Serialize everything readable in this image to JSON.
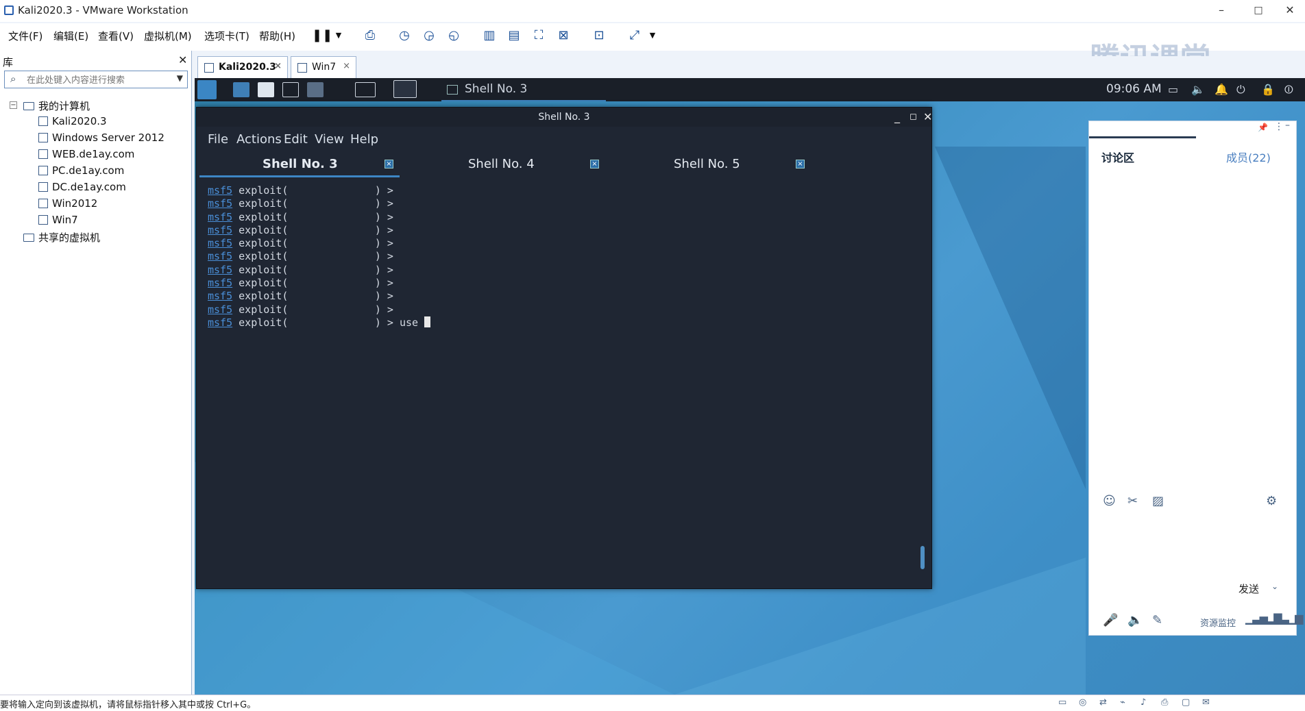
{
  "window": {
    "title": "Kali2020.3 - VMware Workstation",
    "minimize": "–",
    "maximize": "□",
    "close": "✕"
  },
  "menubar": {
    "items": [
      "文件(F)",
      "编辑(E)",
      "查看(V)",
      "虚拟机(M)",
      "选项卡(T)",
      "帮助(H)"
    ]
  },
  "watermark": "腾讯课堂",
  "library": {
    "title": "库",
    "close": "✕",
    "search_placeholder": "在此处键入内容进行搜索",
    "tree": {
      "root": "我的计算机",
      "vms": [
        "Kali2020.3",
        "Windows Server 2012",
        "WEB.de1ay.com",
        "PC.de1ay.com",
        "DC.de1ay.com",
        "Win2012",
        "Win7"
      ],
      "shared": "共享的虚拟机"
    }
  },
  "vm_tabs": [
    {
      "label": "Kali2020.3",
      "close": "×"
    },
    {
      "label": "Win7",
      "close": "×"
    }
  ],
  "kali_panel": {
    "task_label": "Shell No. 3",
    "clock": "09:06 AM"
  },
  "terminal": {
    "title": "Shell No. 3",
    "menu": [
      "File",
      "Actions",
      "Edit",
      "View",
      "Help"
    ],
    "tabs": [
      {
        "label": "Shell No. 3",
        "active": true
      },
      {
        "label": "Shell No. 4",
        "active": false
      },
      {
        "label": "Shell No. 5",
        "active": false
      }
    ],
    "prompt_prefix": "msf5",
    "prompt_body": " exploit(              ) >",
    "prompt_count": 11,
    "last_command": " use "
  },
  "discussion": {
    "tab_discussion": "讨论区",
    "tab_members": "成员(22)",
    "send": "发送",
    "resource_monitor": "资源监控"
  },
  "statusbar": {
    "text": "要将输入定向到该虚拟机，请将鼠标指针移入其中或按 Ctrl+G。"
  }
}
